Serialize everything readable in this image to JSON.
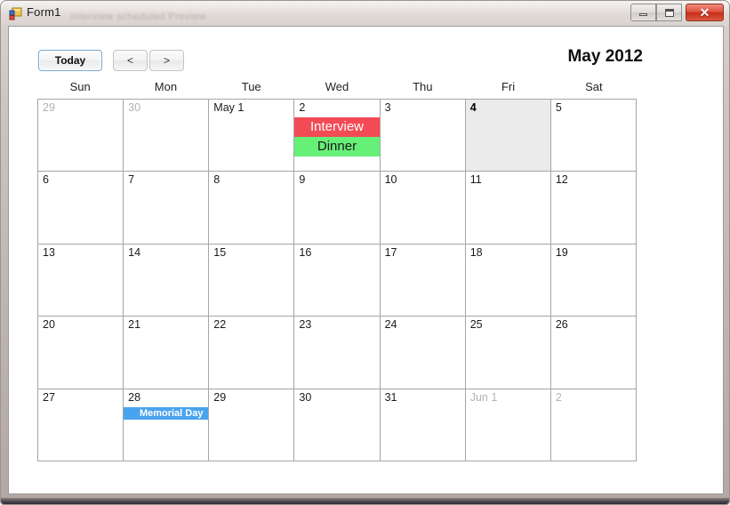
{
  "window": {
    "title": "Form1",
    "ghost_text": "Interview  scheduled  Preview",
    "icon": "form-designer-icon",
    "controls": {
      "minimize_label": "—",
      "maximize_label": "□",
      "close_label": "✕"
    }
  },
  "toolbar": {
    "today_label": "Today",
    "prev_label": "<",
    "next_label": ">",
    "month_title": "May 2012"
  },
  "calendar": {
    "day_headers": [
      "Sun",
      "Mon",
      "Tue",
      "Wed",
      "Thu",
      "Fri",
      "Sat"
    ],
    "colors": {
      "grid_line": "#a6a6a6",
      "today_bg": "#ebebeb",
      "other_month_text": "#b3b3b3",
      "event_red_bg": "#f24b55",
      "event_red_text": "#ffffff",
      "event_green_bg": "#66f077",
      "event_green_text": "#1a1a1a",
      "event_blue_bg": "#4aa3ee",
      "event_blue_text": "#ffffff"
    },
    "weeks": [
      [
        {
          "label": "29",
          "other": true,
          "today": false,
          "events": []
        },
        {
          "label": "30",
          "other": true,
          "today": false,
          "events": []
        },
        {
          "label": "May 1",
          "other": false,
          "today": false,
          "events": []
        },
        {
          "label": "2",
          "other": false,
          "today": false,
          "events": [
            {
              "title": "Interview",
              "bg": "#f24b55",
              "fg": "#ffffff",
              "size": "big"
            },
            {
              "title": "Dinner",
              "bg": "#66f077",
              "fg": "#1a1a1a",
              "size": "big"
            }
          ]
        },
        {
          "label": "3",
          "other": false,
          "today": false,
          "events": []
        },
        {
          "label": "4",
          "other": false,
          "today": true,
          "events": []
        },
        {
          "label": "5",
          "other": false,
          "today": false,
          "events": []
        }
      ],
      [
        {
          "label": "6",
          "other": false,
          "today": false,
          "events": []
        },
        {
          "label": "7",
          "other": false,
          "today": false,
          "events": []
        },
        {
          "label": "8",
          "other": false,
          "today": false,
          "events": []
        },
        {
          "label": "9",
          "other": false,
          "today": false,
          "events": []
        },
        {
          "label": "10",
          "other": false,
          "today": false,
          "events": []
        },
        {
          "label": "11",
          "other": false,
          "today": false,
          "events": []
        },
        {
          "label": "12",
          "other": false,
          "today": false,
          "events": []
        }
      ],
      [
        {
          "label": "13",
          "other": false,
          "today": false,
          "events": []
        },
        {
          "label": "14",
          "other": false,
          "today": false,
          "events": []
        },
        {
          "label": "15",
          "other": false,
          "today": false,
          "events": []
        },
        {
          "label": "16",
          "other": false,
          "today": false,
          "events": []
        },
        {
          "label": "17",
          "other": false,
          "today": false,
          "events": []
        },
        {
          "label": "18",
          "other": false,
          "today": false,
          "events": []
        },
        {
          "label": "19",
          "other": false,
          "today": false,
          "events": []
        }
      ],
      [
        {
          "label": "20",
          "other": false,
          "today": false,
          "events": []
        },
        {
          "label": "21",
          "other": false,
          "today": false,
          "events": []
        },
        {
          "label": "22",
          "other": false,
          "today": false,
          "events": []
        },
        {
          "label": "23",
          "other": false,
          "today": false,
          "events": []
        },
        {
          "label": "24",
          "other": false,
          "today": false,
          "events": []
        },
        {
          "label": "25",
          "other": false,
          "today": false,
          "events": []
        },
        {
          "label": "26",
          "other": false,
          "today": false,
          "events": []
        }
      ],
      [
        {
          "label": "27",
          "other": false,
          "today": false,
          "events": []
        },
        {
          "label": "28",
          "other": false,
          "today": false,
          "events": [
            {
              "title": "Memorial Day",
              "bg": "#4aa3ee",
              "fg": "#ffffff",
              "size": "small"
            }
          ]
        },
        {
          "label": "29",
          "other": false,
          "today": false,
          "events": []
        },
        {
          "label": "30",
          "other": false,
          "today": false,
          "events": []
        },
        {
          "label": "31",
          "other": false,
          "today": false,
          "events": []
        },
        {
          "label": "Jun 1",
          "other": true,
          "today": false,
          "events": []
        },
        {
          "label": "2",
          "other": true,
          "today": false,
          "events": []
        }
      ]
    ]
  }
}
